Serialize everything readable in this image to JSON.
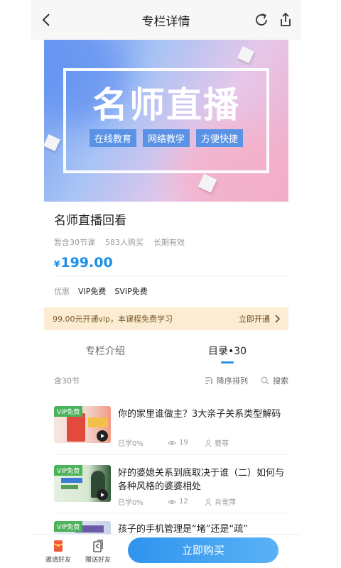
{
  "header": {
    "title": "专栏详情"
  },
  "banner": {
    "headline": "名师直播",
    "tags": [
      "在线教育",
      "网络教学",
      "方便快捷"
    ]
  },
  "course": {
    "name": "名师直播回看",
    "meta": [
      "暂含30节课",
      "583人购买",
      "长期有效"
    ],
    "price_symbol": "¥",
    "price": "199.00"
  },
  "promo": {
    "label": "优惠",
    "items": [
      "VIP免费",
      "SVIP免费"
    ]
  },
  "vip_bar": {
    "text": "99.00元开通vip，本课程免费学习",
    "action": "立即开通"
  },
  "tabs": [
    {
      "label": "专栏介绍",
      "active": false
    },
    {
      "label": "目录•30",
      "active": true
    }
  ],
  "list_header": {
    "count": "含30节",
    "sort": "降序排列",
    "search": "搜索"
  },
  "items": [
    {
      "badge": "VIP免费",
      "title": "你的家里谁做主？3大亲子关系类型解码",
      "progress": "已学0%",
      "views": "19",
      "author": "费菲"
    },
    {
      "badge": "VIP免费",
      "title": "好的婆媳关系到底取决于谁（二）如何与各种风格的婆婆相处",
      "progress": "已学0%",
      "views": "12",
      "author": "肖雪萍"
    },
    {
      "badge": "VIP免费",
      "title": "孩子的手机管理是“堵”还是“疏”",
      "progress": "",
      "views": "",
      "author": ""
    }
  ],
  "bottom_bar": {
    "invite": "邀请好友",
    "gift": "赠送好友",
    "buy": "立即购买"
  },
  "colors": {
    "accent": "#2b8fe8",
    "price": "#1a8ee8",
    "vip_bar_bg": "#fbecd2",
    "badge_green": "#4bb35a"
  }
}
